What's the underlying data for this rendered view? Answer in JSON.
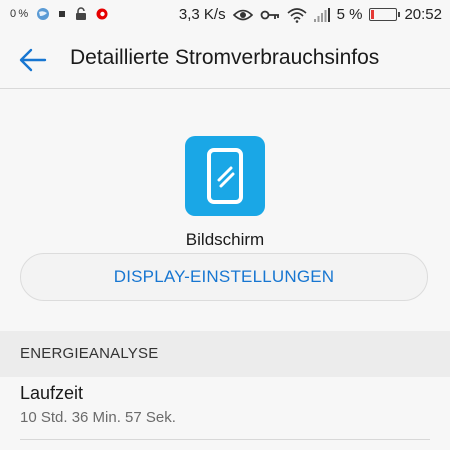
{
  "statusbar": {
    "data_usage": "0 %",
    "speed": "3,3 K/s",
    "battery_percent": "5 %",
    "time": "20:52",
    "icons": [
      "globe-icon",
      "sim-icon",
      "lock-icon",
      "vodafone-icon",
      "eye-icon",
      "key-icon",
      "wifi-icon",
      "signal-icon",
      "battery-icon"
    ],
    "battery_level": 0.05,
    "battery_color": "#e53935"
  },
  "header": {
    "back_icon": "arrow-left-icon",
    "title": "Detaillierte Stromverbrauchsinfos"
  },
  "app": {
    "icon": "phone-screen-icon",
    "icon_color": "#1aa7e6",
    "name": "Bildschirm",
    "settings_button": "DISPLAY-EINSTELLUNGEN"
  },
  "section": {
    "title": "ENERGIEANALYSE"
  },
  "runtime": {
    "label": "Laufzeit",
    "value": "10 Std. 36 Min. 57 Sek."
  },
  "colors": {
    "accent": "#1776d1",
    "background": "#f7f7f7",
    "section_bg": "#ececec"
  }
}
